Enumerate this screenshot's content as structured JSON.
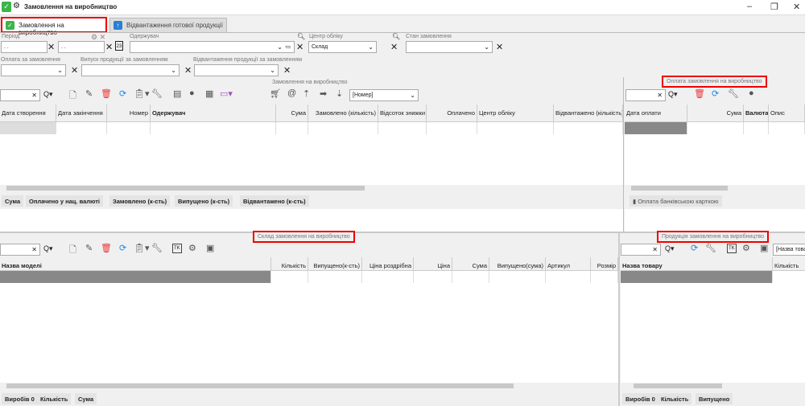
{
  "window": {
    "title": "Замовлення на виробництво",
    "controls": [
      "–",
      "❐",
      "✕"
    ]
  },
  "tabs": [
    {
      "label": "Замовлення на виробництво",
      "active": true
    },
    {
      "label": "Відвантаження готової продукції",
      "active": false
    }
  ],
  "filters": {
    "period_label": "Період",
    "date_from": ". .",
    "date_to": ". .",
    "recipient_label": "Одержувач",
    "recipient_value": "",
    "account_center_label": "Центр обліку",
    "account_center_value": "Склад",
    "order_state_label": "Стан замовлення",
    "order_state_value": "",
    "payment_label": "Оплата за замовлення",
    "release_label": "Випуск продукції за замовленням",
    "shipment_label": "Відвантаження продукції за замовленням"
  },
  "orders": {
    "section_title": "Замовлення на виробництво",
    "sort_select": "[Номер]",
    "columns": [
      "Дата створення",
      "Дата закінчення",
      "Номер",
      "Одержувач",
      "Сума",
      "Замовлено (кількість)",
      "Відсоток знижки",
      "Оплачено",
      "Центр обліку",
      "Відвантажено (кількість)"
    ],
    "footer": [
      "Сума",
      "Оплачено у нац. валюті",
      "Замовлено (к-сть)",
      "Випущено (к-сть)",
      "Відвантажено (к-сть)"
    ]
  },
  "payments": {
    "section_title": "Оплата замовлення на виробництво",
    "columns": [
      "Дата оплати",
      "Сума",
      "Валюта",
      "Опис"
    ],
    "card_button": "Оплата банківською карткою"
  },
  "stock": {
    "section_title": "Склад замовлення на виробництво",
    "columns": [
      "Назва моделі",
      "Кількість",
      "Випущено(к-сть)",
      "Ціна роздрібна",
      "Ціна",
      "Сума",
      "Випущено(сума)",
      "Артикул",
      "Розмір"
    ],
    "footer": [
      "Виробів 0",
      "Кількість",
      "Сума"
    ]
  },
  "products": {
    "section_title": "Продукція замовлення на виробництво",
    "sort_select": "[Назва товару]",
    "columns": [
      "Назва товару",
      "Кількість"
    ],
    "footer": [
      "Виробів 0",
      "Кількість",
      "Випущено"
    ]
  },
  "colors": {
    "accent_red": "#e00000",
    "selected_cell": "#888888"
  }
}
